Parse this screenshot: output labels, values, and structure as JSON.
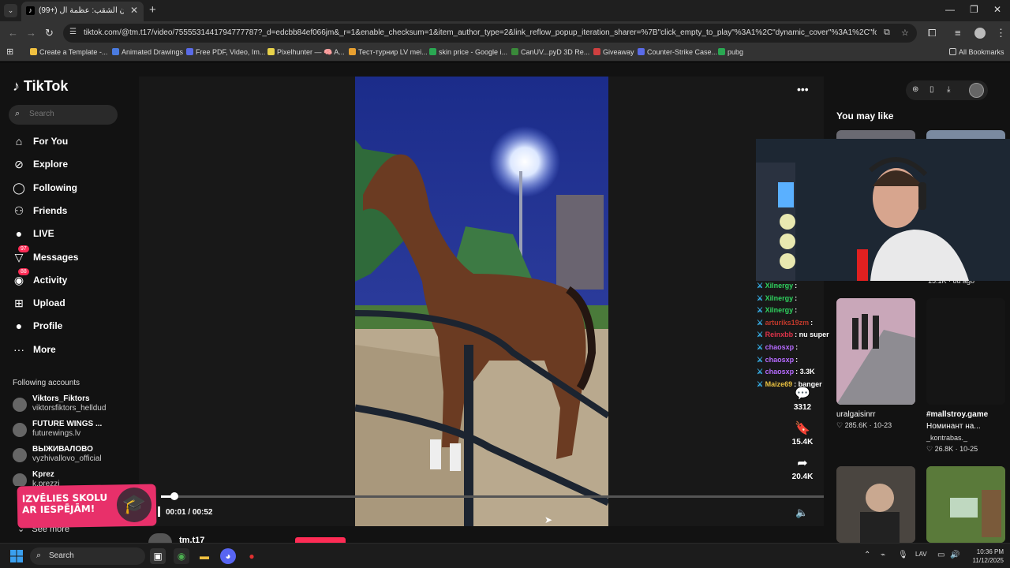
{
  "browser": {
    "tab_title": "(99+) مروان الشقب: عظمة ال",
    "url": "tiktok.com/@tm.t17/video/7555531441794777787?_d=edcbb84ef066jm&_r=1&enable_checksum=1&item_author_type=2&link_reflow_popup_iteration_sharer=%7B\"click_empty_to_play\"%3A1%2C\"dynamic_cover\"%3A1%2C\"follow_to_play_dur...",
    "bookmarks": [
      {
        "label": "Create a Template -...",
        "color": "#f0c040"
      },
      {
        "label": "Animated Drawings",
        "color": "#4a7be0"
      },
      {
        "label": "Free PDF, Video, Im...",
        "color": "#5a6be8"
      },
      {
        "label": "Pixelhunter — 🧠 A...",
        "color": "#e8d24a"
      },
      {
        "label": "Тест-турнир LV mei...",
        "color": "#e8a030"
      },
      {
        "label": "skin price - Google i...",
        "color": "#2aa852"
      },
      {
        "label": "CanUV...pyD 3D Re...",
        "color": "#3a8a3a"
      },
      {
        "label": "Giveaway",
        "color": "#d04040"
      },
      {
        "label": "Counter-Strike Case...",
        "color": "#5a6be8"
      },
      {
        "label": "pubg",
        "color": "#2aa852"
      }
    ],
    "all_bookmarks": "All Bookmarks"
  },
  "tiktok": {
    "logo": "TikTok",
    "search_placeholder": "Search",
    "nav": [
      {
        "label": "For You",
        "icon": "⌂"
      },
      {
        "label": "Explore",
        "icon": "⊘"
      },
      {
        "label": "Following",
        "icon": "◯"
      },
      {
        "label": "Friends",
        "icon": "⚇"
      },
      {
        "label": "LIVE",
        "icon": "●"
      },
      {
        "label": "Messages",
        "icon": "▽",
        "badge": "97"
      },
      {
        "label": "Activity",
        "icon": "◉",
        "badge": "88"
      },
      {
        "label": "Upload",
        "icon": "⊞"
      },
      {
        "label": "Profile",
        "icon": "●"
      },
      {
        "label": "More",
        "icon": "···"
      }
    ],
    "following_title": "Following accounts",
    "accounts": [
      {
        "name": "Viktors_Fiktors",
        "handle": "viktorsfiktors_helldud"
      },
      {
        "name": "FUTURE WINGS ...",
        "handle": "futurewings.lv"
      },
      {
        "name": "ВЫЖИВАЛОВО",
        "handle": "vyzhivallovo_official"
      },
      {
        "name": "Kprez",
        "handle": "k.prezzi"
      }
    ],
    "see_more": "See more",
    "promo_text": "IZVĒLIES SKOLU AR IESPĒJĀM!",
    "video": {
      "time": "00:01 / 00:52",
      "progress": 0.02,
      "author": "tm.t17"
    },
    "actions": [
      {
        "icon": "💬",
        "count": "3312"
      },
      {
        "icon": "🔖",
        "count": "15.4K"
      },
      {
        "icon": "➦",
        "count": "20.4K"
      }
    ],
    "you_may_like": "You may like",
    "recommendations": [
      {
        "title": "uralgaisinrr",
        "likes": "285.6K",
        "date": "10-23"
      },
      {
        "title": "#mallstroy.game",
        "sub": "Номинант на...",
        "author": "_kontrabas._",
        "likes": "26.8K",
        "date": "10-25"
      }
    ],
    "rec_top_meta": "15.1K · 8d ago"
  },
  "chat": [
    {
      "user": "Xilnergy",
      "msg": ":",
      "color": "#2fd35f"
    },
    {
      "user": "Xilnergy",
      "msg": ":",
      "color": "#2fd35f"
    },
    {
      "user": "Xilnergy",
      "msg": ":",
      "color": "#2fd35f"
    },
    {
      "user": "arturiks19zm",
      "msg": ":",
      "color": "#c0392b"
    },
    {
      "user": "Reinxbb",
      "msg": ": nu super",
      "color": "#e0334a"
    },
    {
      "user": "chaosxp",
      "msg": ":",
      "color": "#b66bff"
    },
    {
      "user": "chaosxp",
      "msg": ":",
      "color": "#b66bff"
    },
    {
      "user": "chaosxp",
      "msg": ": 3.3K",
      "color": "#b66bff"
    },
    {
      "user": "Maize69",
      "msg": ": banger",
      "color": "#e8c040"
    }
  ],
  "taskbar": {
    "search_label": "Search",
    "lang": "LAV",
    "time": "10:36 PM",
    "date": "11/12/2025"
  },
  "colors": {
    "accent": "#fe2c55",
    "bg": "#121212"
  }
}
